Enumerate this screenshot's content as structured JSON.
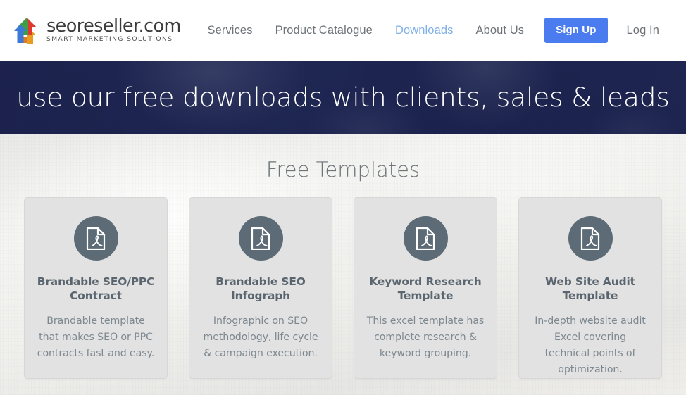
{
  "header": {
    "logo": {
      "icon": "house-arrows-logo-icon",
      "name": "seoreseller.com",
      "tagline": "SMART MARKETING SOLUTIONS",
      "colors": {
        "red": "#e0382e",
        "green": "#3f9c48",
        "blue": "#3b78d8",
        "yellow": "#e8b229",
        "orange": "#e07b25",
        "wordmark": "#3b3b3b"
      }
    },
    "nav": [
      {
        "label": "Services",
        "active": false
      },
      {
        "label": "Product Catalogue",
        "active": false
      },
      {
        "label": "Downloads",
        "active": true
      },
      {
        "label": "About Us",
        "active": false
      }
    ],
    "signup_label": "Sign Up",
    "login_label": "Log In",
    "colors": {
      "nav_text": "#6d7378",
      "nav_active": "#7fb0e8",
      "signup_bg": "#4a7cf0",
      "signup_text": "#ffffff",
      "background": "#ffffff"
    }
  },
  "hero": {
    "title": "use our free downloads with clients, sales & leads",
    "colors": {
      "overlay": "#1e2551",
      "text": "#ffffff"
    }
  },
  "main": {
    "section_title": "Free Templates",
    "colors": {
      "background": "#efefee",
      "section_title": "#6f7479",
      "card_bg": "#e1e2e1",
      "card_border": "#d6d7d6",
      "icon_circle": "#5c6b76",
      "card_title": "#5a656f",
      "card_desc": "#7e8890"
    },
    "cards": [
      {
        "icon": "file-pdf-icon",
        "title": "Brandable SEO/PPC Contract",
        "description": "Brandable template that makes SEO or PPC contracts fast and easy."
      },
      {
        "icon": "file-pdf-icon",
        "title": "Brandable SEO Infograph",
        "description": "Infographic on SEO methodology, life cycle & campaign execution."
      },
      {
        "icon": "file-pdf-icon",
        "title": "Keyword Research Template",
        "description": "This excel template has complete research & keyword grouping."
      },
      {
        "icon": "file-pdf-icon",
        "title": "Web Site Audit Template",
        "description": "In-depth website audit Excel covering technical points of optimization."
      }
    ]
  }
}
